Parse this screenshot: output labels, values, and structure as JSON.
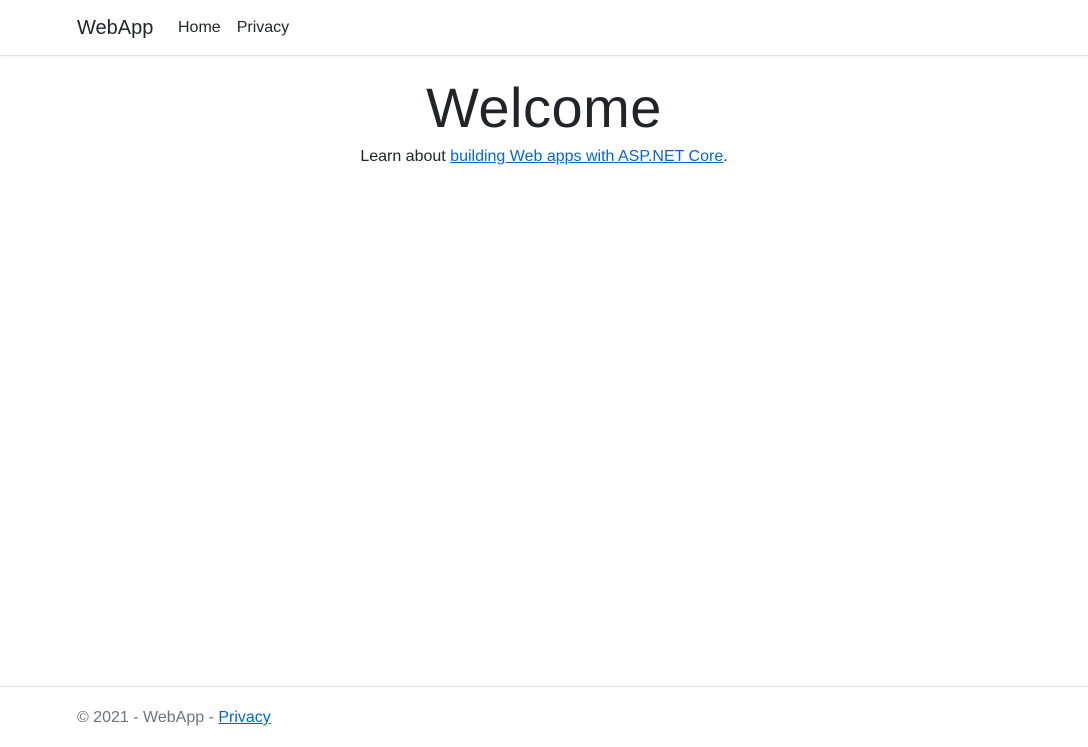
{
  "header": {
    "brand": "WebApp",
    "nav": [
      {
        "label": "Home"
      },
      {
        "label": "Privacy"
      }
    ]
  },
  "main": {
    "title": "Welcome",
    "lead_prefix": "Learn about ",
    "lead_link": "building Web apps with ASP.NET Core",
    "lead_suffix": "."
  },
  "footer": {
    "text": "© 2021 - WebApp - ",
    "link": "Privacy"
  },
  "colors": {
    "link": "#0366d6",
    "muted": "#6c757d",
    "text": "#212529"
  }
}
